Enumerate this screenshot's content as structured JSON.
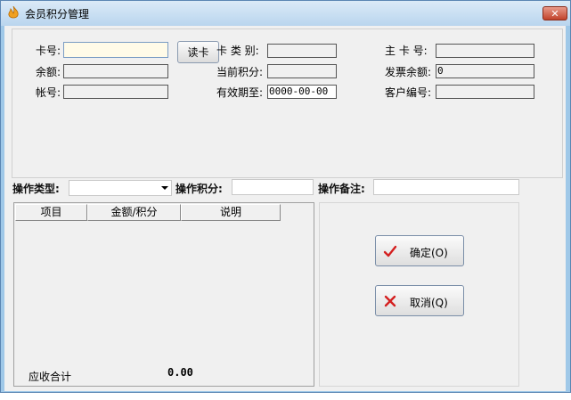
{
  "window": {
    "title": "会员积分管理",
    "close_label": "✕"
  },
  "card_info": {
    "card_no_label": "卡号:",
    "read_card_button": "读卡",
    "card_type_label": "卡 类 别:",
    "main_card_label": "主 卡 号:",
    "balance_label": "余额:",
    "current_points_label": "当前积分:",
    "invoice_balance_label": "发票余额:",
    "invoice_balance_value": "0",
    "account_label": "帐号:",
    "expiry_label": "有效期至:",
    "expiry_value": "0000-00-00",
    "customer_no_label": "客户编号:"
  },
  "operation": {
    "type_label": "操作类型:",
    "points_label": "操作积分:",
    "remark_label": "操作备注:"
  },
  "table": {
    "columns": [
      "项目",
      "金额/积分",
      "说明"
    ],
    "total_label": "应收合计",
    "total_value": "0.00"
  },
  "buttons": {
    "confirm_label": "确定(O)",
    "cancel_label": "取消(Q)"
  },
  "colors": {
    "confirm_icon": "#d42020",
    "cancel_icon": "#d42020",
    "title_bar": "#c7ddf1"
  }
}
